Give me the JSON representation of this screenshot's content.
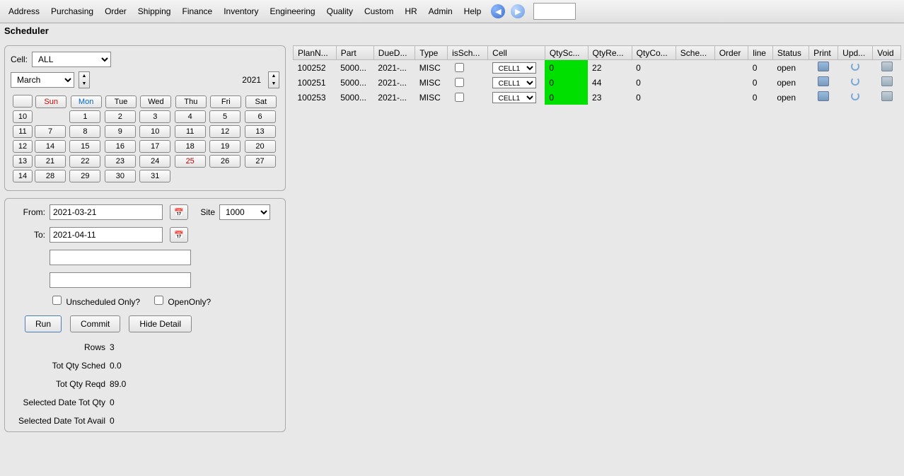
{
  "menu": [
    "Address",
    "Purchasing",
    "Order",
    "Shipping",
    "Finance",
    "Inventory",
    "Engineering",
    "Quality",
    "Custom",
    "HR",
    "Admin",
    "Help"
  ],
  "title": "Scheduler",
  "cellFilter": {
    "label": "Cell:",
    "value": "ALL"
  },
  "calendar": {
    "month": "March",
    "year": "2021",
    "dayHeaders": [
      "Sun",
      "Mon",
      "Tue",
      "Wed",
      "Thu",
      "Fri",
      "Sat"
    ],
    "weeks": [
      {
        "wk": "10",
        "days": [
          "",
          "1",
          "2",
          "3",
          "4",
          "5",
          "6"
        ]
      },
      {
        "wk": "11",
        "days": [
          "7",
          "8",
          "9",
          "10",
          "11",
          "12",
          "13"
        ]
      },
      {
        "wk": "12",
        "days": [
          "14",
          "15",
          "16",
          "17",
          "18",
          "19",
          "20"
        ]
      },
      {
        "wk": "13",
        "days": [
          "21",
          "22",
          "23",
          "24",
          "25",
          "26",
          "27"
        ]
      },
      {
        "wk": "14",
        "days": [
          "28",
          "29",
          "30",
          "31",
          "",
          "",
          ""
        ]
      }
    ],
    "today": "25"
  },
  "filter": {
    "fromLabel": "From:",
    "from": "2021-03-21",
    "toLabel": "To:",
    "to": "2021-04-11",
    "siteLabel": "Site",
    "site": "1000",
    "unschedLabel": "Unscheduled Only?",
    "openLabel": "OpenOnly?",
    "run": "Run",
    "commit": "Commit",
    "hide": "Hide Detail"
  },
  "summary": {
    "rowsLabel": "Rows",
    "rows": "3",
    "totSchedLabel": "Tot Qty Sched",
    "totSched": "0.0",
    "totReqdLabel": "Tot Qty Reqd",
    "totReqd": "89.0",
    "selQtyLabel": "Selected Date Tot Qty",
    "selQty": "0",
    "selAvailLabel": "Selected Date Tot Avail",
    "selAvail": "0"
  },
  "grid": {
    "headers": [
      "PlanN...",
      "Part",
      "DueD...",
      "Type",
      "isSch...",
      "Cell",
      "QtySc...",
      "QtyRe...",
      "QtyCo...",
      "Sche...",
      "Order",
      "line",
      "Status",
      "Print",
      "Upd...",
      "Void"
    ],
    "rows": [
      {
        "plan": "100252",
        "part": "5000...",
        "due": "2021-...",
        "type": "MISC",
        "cell": "CELL1",
        "qs": "0",
        "qr": "22",
        "qc": "0",
        "sch": "",
        "ord": "",
        "line": "0",
        "status": "open"
      },
      {
        "plan": "100251",
        "part": "5000...",
        "due": "2021-...",
        "type": "MISC",
        "cell": "CELL1",
        "qs": "0",
        "qr": "44",
        "qc": "0",
        "sch": "",
        "ord": "",
        "line": "0",
        "status": "open"
      },
      {
        "plan": "100253",
        "part": "5000...",
        "due": "2021-...",
        "type": "MISC",
        "cell": "CELL1",
        "qs": "0",
        "qr": "23",
        "qc": "0",
        "sch": "",
        "ord": "",
        "line": "0",
        "status": "open"
      }
    ]
  }
}
